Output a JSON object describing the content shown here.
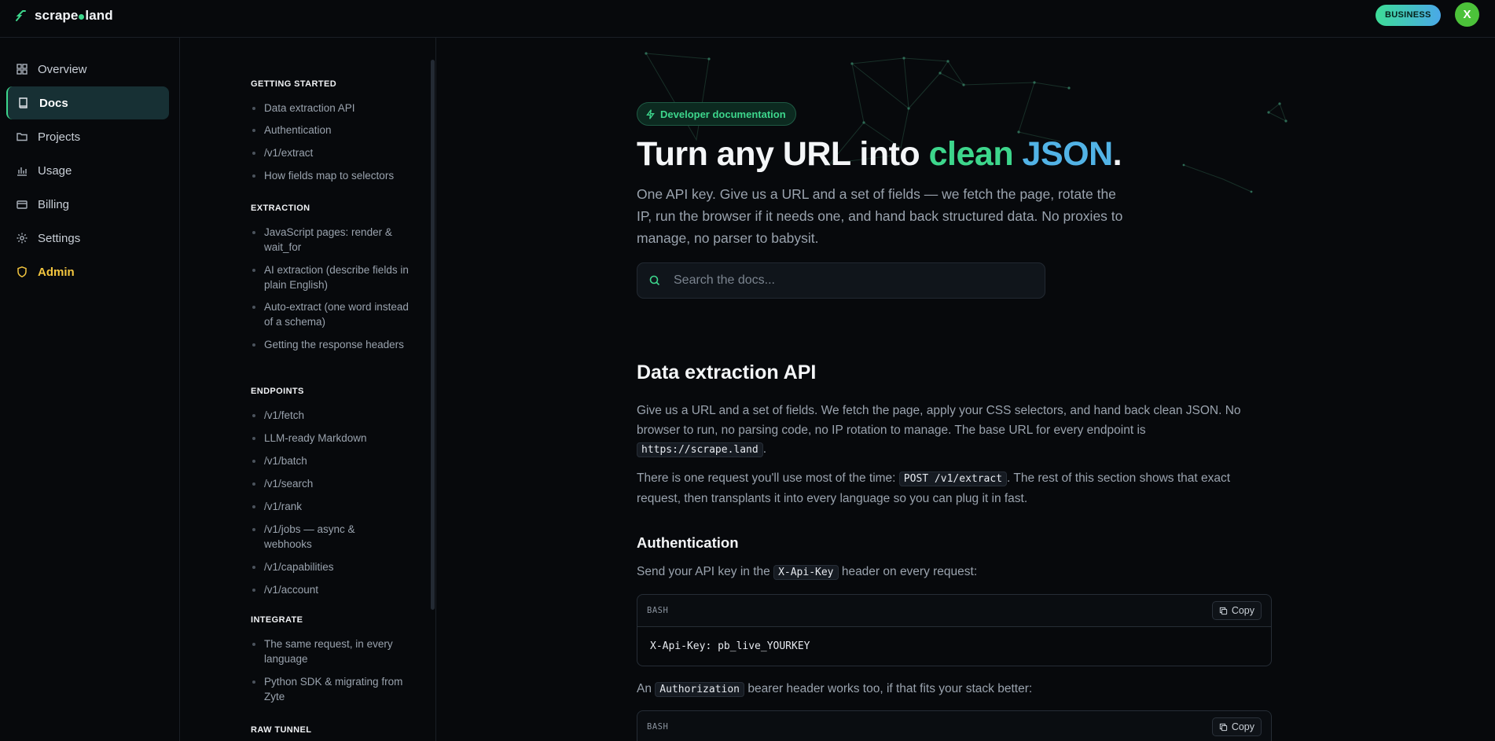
{
  "brand": {
    "name_part1": "scrape",
    "name_part2": "land"
  },
  "header": {
    "plan_badge": "BUSINESS",
    "avatar_initial": "X"
  },
  "sidebar": {
    "items": [
      {
        "label": "Overview",
        "icon": "grid-icon"
      },
      {
        "label": "Docs",
        "icon": "book-icon",
        "active": true
      },
      {
        "label": "Projects",
        "icon": "folder-icon"
      },
      {
        "label": "Usage",
        "icon": "bar-chart-icon"
      },
      {
        "label": "Billing",
        "icon": "credit-card-icon"
      },
      {
        "label": "Settings",
        "icon": "gear-icon"
      },
      {
        "label": "Admin",
        "icon": "shield-icon"
      }
    ]
  },
  "toc": {
    "sections": [
      {
        "title": "GETTING STARTED",
        "items": [
          "Data extraction API",
          "Authentication",
          "/v1/extract",
          "How fields map to selectors"
        ]
      },
      {
        "title": "EXTRACTION",
        "items": [
          "JavaScript pages: render & wait_for",
          "AI extraction (describe fields in plain English)",
          "Auto-extract (one word instead of a schema)",
          "Getting the response headers"
        ]
      },
      {
        "title": "ENDPOINTS",
        "items": [
          "/v1/fetch",
          "LLM-ready Markdown",
          "/v1/batch",
          "/v1/search",
          "/v1/rank",
          "/v1/jobs — async & webhooks",
          "/v1/capabilities",
          "/v1/account"
        ]
      },
      {
        "title": "INTEGRATE",
        "items": [
          "The same request, in every language",
          "Python SDK & migrating from Zyte"
        ]
      },
      {
        "title": "RAW TUNNEL",
        "items": []
      }
    ]
  },
  "hero": {
    "badge": "Developer documentation",
    "title_start": "Turn any URL into ",
    "title_green": "clean",
    "title_blue": "JSON",
    "title_end": ".",
    "subtitle": "One API key. Give us a URL and a set of fields — we fetch the page, rotate the IP, run the browser if it needs one, and hand back structured data. No proxies to manage, no parser to babysit."
  },
  "search": {
    "placeholder": "Search the docs..."
  },
  "content": {
    "h2": "Data extraction API",
    "p1_a": "Give us a URL and a set of fields. We fetch the page, apply your CSS selectors, and hand back clean JSON. No browser to run, no parsing code, no IP rotation to manage. The base URL for every endpoint is ",
    "p1_code": "https://scrape.land",
    "p1_b": ".",
    "p2_a": "There is one request you'll use most of the time: ",
    "p2_code": "POST /v1/extract",
    "p2_b": ". The rest of this section shows that exact request, then transplants it into every language so you can plug it in fast.",
    "h3": "Authentication",
    "p3_a": "Send your API key in the ",
    "p3_code": "X-Api-Key",
    "p3_b": " header on every request:",
    "code1_lang": "BASH",
    "code1_copy": "Copy",
    "code1_body": "X-Api-Key: pb_live_YOURKEY",
    "p4_a": "An ",
    "p4_code": "Authorization",
    "p4_b": " bearer header works too, if that fits your stack better:",
    "code2_lang": "BASH",
    "code2_copy": "Copy"
  }
}
